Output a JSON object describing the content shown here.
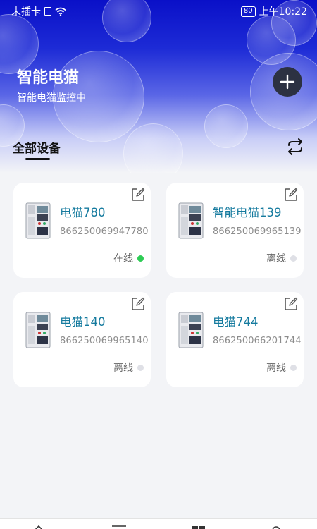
{
  "status_bar": {
    "carrier": "未插卡",
    "battery": "80",
    "time": "上午10:22"
  },
  "header": {
    "title": "智能电猫",
    "subtitle": "智能电猫监控中",
    "add_icon": "plus-icon"
  },
  "section": {
    "title": "全部设备",
    "refresh_icon": "swap-arrows-icon"
  },
  "colors": {
    "header_top": "#0a10c8",
    "device_name": "#147a9e",
    "online_dot": "#2ecc55",
    "offline_dot": "#dfe0e6",
    "add_button": "#2c3142"
  },
  "devices": [
    {
      "name": "电猫780",
      "id": "866250069947780",
      "status": "在线",
      "online": true
    },
    {
      "name": "智能电猫139",
      "id": "866250069965139",
      "status": "离线",
      "online": false
    },
    {
      "name": "电猫140",
      "id": "866250069965140",
      "status": "离线",
      "online": false
    },
    {
      "name": "电猫744",
      "id": "866250066201744",
      "status": "离线",
      "online": false
    }
  ]
}
